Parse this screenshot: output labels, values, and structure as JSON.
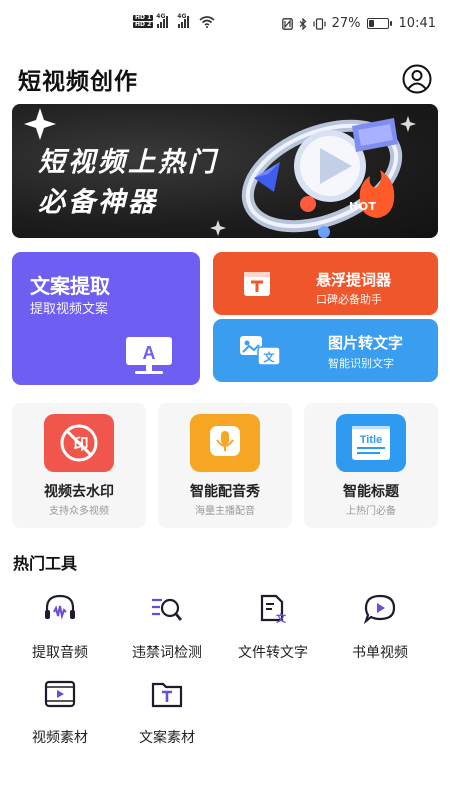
{
  "status_bar": {
    "hd1": "HD 1",
    "hd2": "HD 2",
    "net1": "4G",
    "net2": "4G",
    "battery_percent": "27%",
    "battery_level": 0.27,
    "time": "10:41",
    "icons": [
      "nfc-icon",
      "bluetooth-icon",
      "vibrate-icon",
      "battery-icon"
    ]
  },
  "header": {
    "title": "短视频创作",
    "profile_icon": "user-circle-icon"
  },
  "banner": {
    "line1": "短视频上热门",
    "line2": "必备神器",
    "badge": "HOT"
  },
  "features": {
    "main": {
      "title": "文案提取",
      "subtitle": "提取视频文案",
      "icon": "monitor-a-icon"
    },
    "teleprompter": {
      "title": "悬浮提词器",
      "subtitle": "口碑必备助手",
      "icon": "floating-window-icon"
    },
    "image_to_text": {
      "title": "图片转文字",
      "subtitle": "智能识别文字",
      "icon": "image-text-icon"
    }
  },
  "tiles": [
    {
      "label": "视频去水印",
      "sub": "支持众多视频",
      "icon": "remove-watermark-icon",
      "color": "#f0564b"
    },
    {
      "label": "智能配音秀",
      "sub": "海量主播配音",
      "icon": "microphone-icon",
      "color": "#f6a623"
    },
    {
      "label": "智能标题",
      "sub": "上热门必备",
      "icon": "title-card-icon",
      "color": "#2e9bf0"
    }
  ],
  "hot_tools": {
    "title": "热门工具",
    "items": [
      {
        "label": "提取音频",
        "icon": "audio-wave-icon"
      },
      {
        "label": "违禁词检测",
        "icon": "word-search-icon"
      },
      {
        "label": "文件转文字",
        "icon": "file-convert-icon"
      },
      {
        "label": "书单视频",
        "icon": "play-bubble-icon"
      },
      {
        "label": "视频素材",
        "icon": "video-film-icon"
      },
      {
        "label": "文案素材",
        "icon": "text-folder-icon"
      }
    ]
  },
  "colors": {
    "accent_purple": "#6f5ef2",
    "accent_orange": "#f0562b",
    "accent_blue": "#3a9ef0",
    "icon_purple": "#6a4cd8"
  }
}
